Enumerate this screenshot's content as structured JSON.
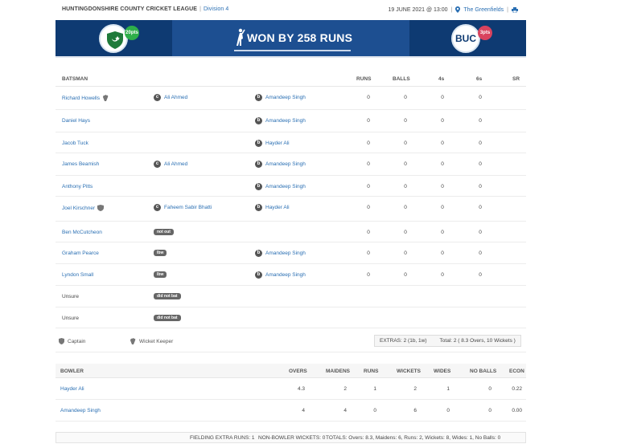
{
  "header": {
    "league": "HUNTINGDONSHIRE COUNTY CRICKET LEAGUE",
    "separator": "|",
    "division": "Division 4",
    "date": "19 JUNE 2021 @ 13:00",
    "venue": "The Greenfields"
  },
  "banner": {
    "home_points": "20pts",
    "result": "WON BY 258 RUNS",
    "away_abbr": "BUC",
    "away_points": "3pts",
    "colors": {
      "dark": "#0e3a72",
      "mid": "#1d4f91",
      "home_pts": "#2eaf4a",
      "away_pts": "#d9435e"
    }
  },
  "batting": {
    "headers": {
      "batsman": "BATSMAN",
      "runs": "RUNS",
      "balls": "BALLS",
      "fours": "4s",
      "sixes": "6s",
      "sr": "SR"
    },
    "rows": [
      {
        "name": "Richard Howells",
        "role_icon": "wicket-keeper-icon",
        "how_mark": "c",
        "how": "Ali Ahmed",
        "bowl_mark": "b",
        "bowler": "Amandeep Singh",
        "runs": "0",
        "balls": "0",
        "fours": "0",
        "sixes": "0",
        "sr": ""
      },
      {
        "name": "Daniel Hays",
        "role_icon": "",
        "how_mark": "",
        "how": "",
        "bowl_mark": "b",
        "bowler": "Amandeep Singh",
        "runs": "0",
        "balls": "0",
        "fours": "0",
        "sixes": "0",
        "sr": ""
      },
      {
        "name": "Jacob Tuck",
        "role_icon": "",
        "how_mark": "",
        "how": "",
        "bowl_mark": "b",
        "bowler": "Hayder Ali",
        "runs": "0",
        "balls": "0",
        "fours": "0",
        "sixes": "0",
        "sr": ""
      },
      {
        "name": "James Beamish",
        "role_icon": "",
        "how_mark": "c",
        "how": "Ali Ahmed",
        "bowl_mark": "b",
        "bowler": "Amandeep Singh",
        "runs": "0",
        "balls": "0",
        "fours": "0",
        "sixes": "0",
        "sr": ""
      },
      {
        "name": "Anthony Pitts",
        "role_icon": "",
        "how_mark": "",
        "how": "",
        "bowl_mark": "b",
        "bowler": "Amandeep Singh",
        "runs": "0",
        "balls": "0",
        "fours": "0",
        "sixes": "0",
        "sr": ""
      },
      {
        "name": "Joel Kirschner",
        "role_icon": "captain-icon",
        "how_mark": "c",
        "how": "Faheem Sabir Bhatti",
        "bowl_mark": "b",
        "bowler": "Hayder Ali",
        "runs": "0",
        "balls": "0",
        "fours": "0",
        "sixes": "0",
        "sr": ""
      },
      {
        "name": "Ben McCutcheon",
        "role_icon": "",
        "how_pill": "not out",
        "bowl_mark": "",
        "bowler": "",
        "runs": "0",
        "balls": "0",
        "fours": "0",
        "sixes": "0",
        "sr": ""
      },
      {
        "name": "Graham Pearce",
        "role_icon": "",
        "how_pill": "lbw",
        "bowl_mark": "b",
        "bowler": "Amandeep Singh",
        "runs": "0",
        "balls": "0",
        "fours": "0",
        "sixes": "0",
        "sr": ""
      },
      {
        "name": "Lyndon Small",
        "role_icon": "",
        "how_pill": "lbw",
        "bowl_mark": "b",
        "bowler": "Amandeep Singh",
        "runs": "0",
        "balls": "0",
        "fours": "0",
        "sixes": "0",
        "sr": ""
      },
      {
        "name": "Unsure",
        "plain": true,
        "how_pill": "did not bat"
      },
      {
        "name": "Unsure",
        "plain": true,
        "how_pill": "did not bat"
      }
    ],
    "legend": {
      "captain": "Captain",
      "keeper": "Wicket Keeper"
    },
    "extras": "EXTRAS: 2 (1b, 1w)",
    "total": "Total: 2 ( 8.3 Overs, 10 Wickets )"
  },
  "bowling": {
    "headers": {
      "bowler": "BOWLER",
      "overs": "OVERS",
      "maidens": "MAIDENS",
      "runs": "RUNS",
      "wickets": "WICKETS",
      "wides": "WIDES",
      "no_balls": "NO BALLS",
      "econ": "ECON"
    },
    "rows": [
      {
        "name": "Hayder Ali",
        "overs": "4.3",
        "maidens": "2",
        "runs": "1",
        "wickets": "2",
        "wides": "1",
        "no_balls": "0",
        "econ": "0.22"
      },
      {
        "name": "Amandeep Singh",
        "overs": "4",
        "maidens": "4",
        "runs": "0",
        "wickets": "6",
        "wides": "0",
        "no_balls": "0",
        "econ": "0.00"
      }
    ]
  },
  "footer": {
    "fielding": "FIELDING EXTRA RUNS: 1",
    "non_bowler": "NON-BOWLER WICKETS: 0",
    "totals": "TOTALS: Overs: 8.3, Maidens: 6, Runs: 2, Wickets: 8, Wides: 1, No Balls: 0"
  }
}
